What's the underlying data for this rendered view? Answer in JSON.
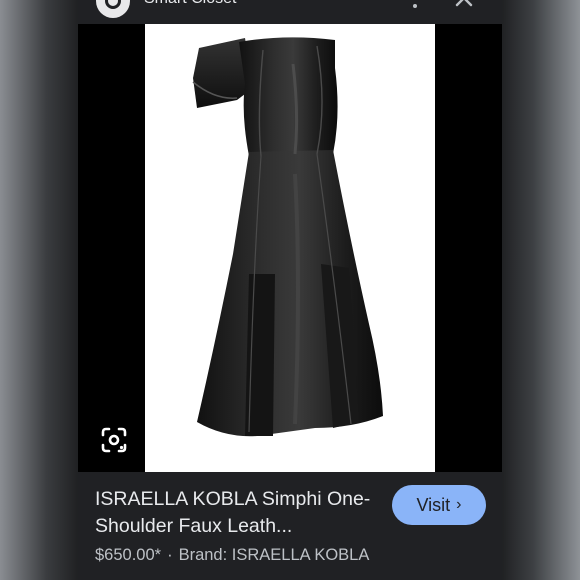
{
  "header": {
    "source_name": "Smart Closet",
    "source_logo_icon": "source-logo-icon",
    "more_icon": "more-vert-icon",
    "close_icon": "close-icon"
  },
  "image": {
    "alt": "Black one-shoulder faux leather midi dress",
    "lens_icon": "google-lens-icon"
  },
  "product": {
    "title": "ISRAELLA KOBLA Simphi One-Shoulder Faux Leath...",
    "price": "$650.00*",
    "separator": "·",
    "brand": "Brand: ISRAELLA KOBLA"
  },
  "visit": {
    "label": "Visit",
    "chevron": "›"
  },
  "colors": {
    "card_background": "#202124",
    "visit_button": "#8ab4f8",
    "image_background": "#000000"
  }
}
